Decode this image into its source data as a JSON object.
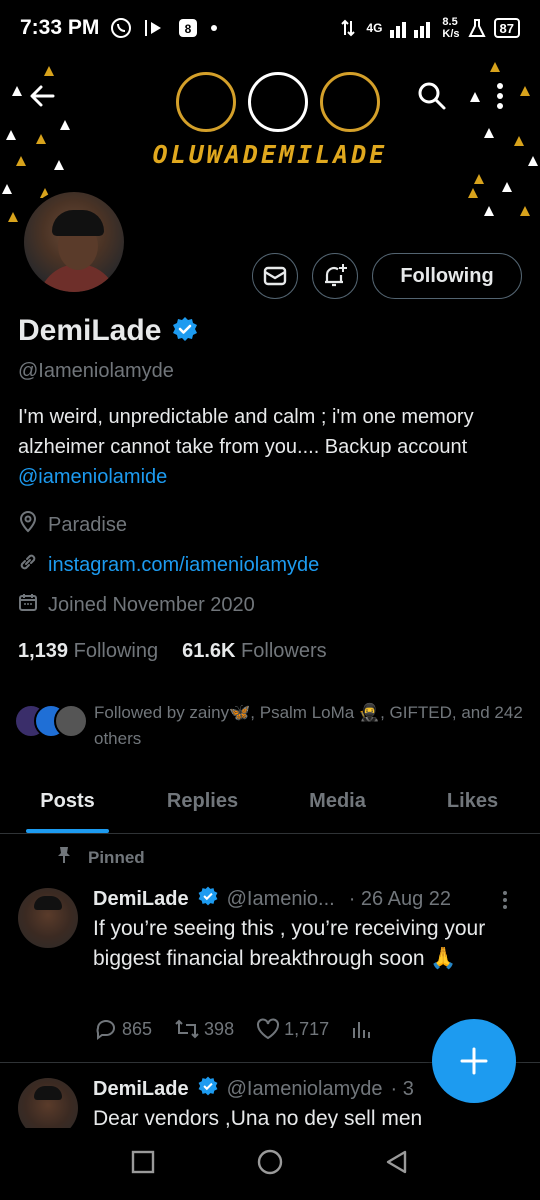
{
  "status_bar": {
    "time": "7:33 PM",
    "network": "4G",
    "speed_value": "8.5",
    "speed_unit": "K/s",
    "battery": "87"
  },
  "banner": {
    "title": "OLUWADEMILADE"
  },
  "profile": {
    "name": "DemiLade",
    "handle": "@Iameniolamyde",
    "bio_text": "I'm weird, unpredictable and calm ; i'm one memory alzheimer cannot take from you.... Backup account ",
    "bio_link": "@iameniolamide",
    "location": "Paradise",
    "website": "instagram.com/iameniolamyde",
    "joined": "Joined November 2020",
    "following_count": "1,139",
    "following_label": "Following",
    "followers_count": "61.6K",
    "followers_label": "Followers",
    "followed_by": "Followed by zainy🦋, Psalm LoMa 🥷, GIFTED, and 242 others",
    "follow_button": "Following",
    "verified_color": "#1d9bf0"
  },
  "tabs": [
    {
      "label": "Posts",
      "active": true
    },
    {
      "label": "Replies",
      "active": false
    },
    {
      "label": "Media",
      "active": false
    },
    {
      "label": "Likes",
      "active": false
    }
  ],
  "tweets": [
    {
      "pinned_label": "Pinned",
      "name": "DemiLade",
      "handle": "@Iamenio...",
      "date": "· 26 Aug 22",
      "text": "If you’re seeing this , you’re receiving your biggest financial breakthrough soon 🙏",
      "replies": "865",
      "retweets": "398",
      "likes": "1,717"
    },
    {
      "name": "DemiLade",
      "handle": "@Iameniolamyde",
      "date": "· 3",
      "text": "Dear vendors ,Una no dey sell men"
    }
  ],
  "colors": {
    "accent": "#1d9bf0",
    "gold": "#d8a31c",
    "muted": "#71767b"
  }
}
